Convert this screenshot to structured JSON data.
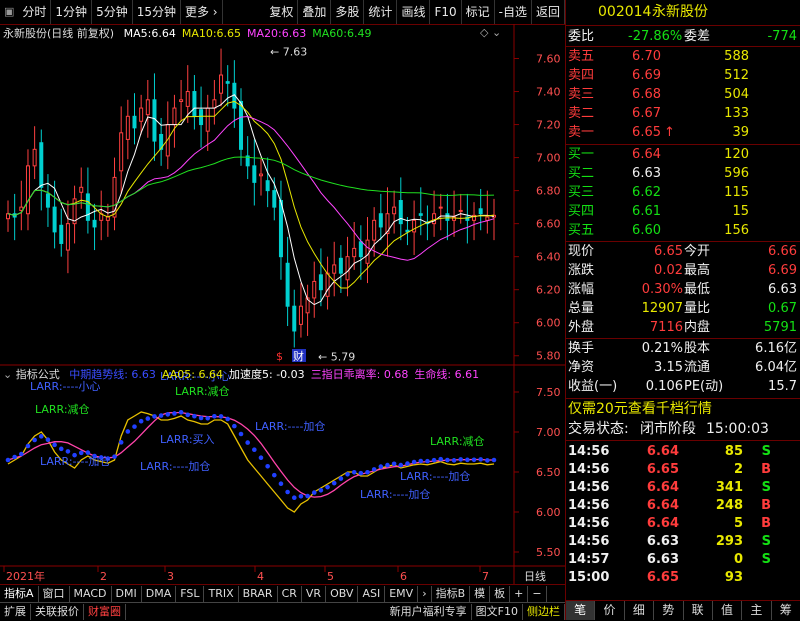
{
  "toolbar": {
    "periods": [
      "分时",
      "1分钟",
      "5分钟",
      "15分钟",
      "更多 ›"
    ],
    "tools": [
      "复权",
      "叠加",
      "多股",
      "统计",
      "画线",
      "F10",
      "标记",
      "-自选",
      "返回"
    ]
  },
  "main_chart": {
    "title": "永新股份(日线 前复权)",
    "ma": [
      {
        "label": "MA5:",
        "value": "6.64",
        "color": "#ffffff"
      },
      {
        "label": "MA10:",
        "value": "6.65",
        "color": "#e8e800"
      },
      {
        "label": "MA20:",
        "value": "6.63",
        "color": "#ff44ff"
      },
      {
        "label": "MA60:",
        "value": "6.49",
        "color": "#20e020"
      }
    ],
    "y_ticks": [
      "7.60",
      "7.40",
      "7.20",
      "7.00",
      "6.80",
      "6.60",
      "6.40",
      "6.20",
      "6.00",
      "5.80"
    ],
    "high_label": "7.63",
    "low_label": "5.79",
    "marker1": "$",
    "marker2": "财"
  },
  "indicator": {
    "title": "指标公式",
    "items": [
      {
        "label": "中期趋势线:",
        "value": "6.63",
        "color": "#3a4cff"
      },
      {
        "label": "AA05:",
        "value": "6.64",
        "color": "#e8e800"
      },
      {
        "label": "加速度5:",
        "value": "-0.03",
        "color": "#ffffff"
      },
      {
        "label": "三指日乖离率:",
        "value": "0.68",
        "color": "#ff44ff"
      },
      {
        "label": "生命线:",
        "value": "6.61",
        "color": "#ff44ff"
      }
    ],
    "y_ticks": [
      "7.50",
      "7.00",
      "6.50",
      "6.00",
      "5.50"
    ],
    "annotations": [
      {
        "text": "LARR:----小心",
        "color": "#4060ff"
      },
      {
        "text": "LARR:减仓",
        "color": "#20e020"
      },
      {
        "text": "LARR:----小心",
        "color": "#4060ff"
      },
      {
        "text": "LARR:减仓",
        "color": "#20e020"
      },
      {
        "text": "LARR:----加仓",
        "color": "#4060ff"
      },
      {
        "text": "LARR:----加仓",
        "color": "#4060ff"
      },
      {
        "text": "LARR:买入",
        "color": "#4060ff"
      },
      {
        "text": "LARR:----加仓",
        "color": "#4060ff"
      },
      {
        "text": "LARR:----加仓",
        "color": "#4060ff"
      },
      {
        "text": "LARR:----加仓",
        "color": "#4060ff"
      },
      {
        "text": "LARR:减仓",
        "color": "#20e020"
      }
    ]
  },
  "x_axis": {
    "labels": [
      "2021年",
      "2",
      "3",
      "4",
      "5",
      "6",
      "7"
    ],
    "right_label": "日线"
  },
  "tabs_row1": [
    "指标A",
    "窗口",
    "MACD",
    "DMI",
    "DMA",
    "FSL",
    "TRIX",
    "BRAR",
    "CR",
    "VR",
    "OBV",
    "ASI",
    "EMV",
    "›",
    "指标B",
    "模",
    "板",
    "+",
    "−"
  ],
  "tabs_row2": {
    "left": [
      "扩展",
      "关联报价",
      "财富圈"
    ],
    "right": [
      "新用户福利专享",
      "图文F10",
      "侧边栏"
    ]
  },
  "quote": {
    "code": "002014",
    "name": "永新股份",
    "weibi_label": "委比",
    "weibi": "-27.86%",
    "weicha_label": "委差",
    "weicha": "-774",
    "sells": [
      {
        "label": "卖五",
        "price": "6.70",
        "vol": "588",
        "arrow": ""
      },
      {
        "label": "卖四",
        "price": "6.69",
        "vol": "512",
        "arrow": ""
      },
      {
        "label": "卖三",
        "price": "6.68",
        "vol": "504",
        "arrow": ""
      },
      {
        "label": "卖二",
        "price": "6.67",
        "vol": "133",
        "arrow": ""
      },
      {
        "label": "卖一",
        "price": "6.65",
        "vol": "39",
        "arrow": "↑"
      }
    ],
    "buys": [
      {
        "label": "买一",
        "price": "6.64",
        "vol": "120",
        "pc": "red"
      },
      {
        "label": "买二",
        "price": "6.63",
        "vol": "596",
        "pc": "wht"
      },
      {
        "label": "买三",
        "price": "6.62",
        "vol": "115",
        "pc": "grn"
      },
      {
        "label": "买四",
        "price": "6.61",
        "vol": "15",
        "pc": "grn"
      },
      {
        "label": "买五",
        "price": "6.60",
        "vol": "156",
        "pc": "grn"
      }
    ],
    "stats": [
      {
        "l1": "现价",
        "v1": "6.65",
        "c1": "red",
        "l2": "今开",
        "v2": "6.66",
        "c2": "red"
      },
      {
        "l1": "涨跌",
        "v1": "0.02",
        "c1": "red",
        "l2": "最高",
        "v2": "6.69",
        "c2": "red"
      },
      {
        "l1": "涨幅",
        "v1": "0.30%",
        "c1": "red",
        "l2": "最低",
        "v2": "6.63",
        "c2": "wht"
      },
      {
        "l1": "总量",
        "v1": "12907",
        "c1": "yel",
        "l2": "量比",
        "v2": "0.67",
        "c2": "grn"
      },
      {
        "l1": "外盘",
        "v1": "7116",
        "c1": "red",
        "l2": "内盘",
        "v2": "5791",
        "c2": "grn"
      }
    ],
    "stats2": [
      {
        "l1": "换手",
        "v1": "0.21%",
        "l2": "股本",
        "v2": "6.16亿"
      },
      {
        "l1": "净资",
        "v1": "3.15",
        "l2": "流通",
        "v2": "6.04亿"
      },
      {
        "l1": "收益(一)",
        "v1": "0.106",
        "l2": "PE(动)",
        "v2": "15.7"
      }
    ],
    "promo": "仅需20元查看千档行情",
    "status_label": "交易状态:",
    "status": "闭市阶段",
    "status_time": "15:00:03",
    "trades": [
      {
        "t": "14:56",
        "p": "6.64",
        "pc": "red",
        "v": "85",
        "bs": "S"
      },
      {
        "t": "14:56",
        "p": "6.65",
        "pc": "red",
        "v": "2",
        "bs": "B"
      },
      {
        "t": "14:56",
        "p": "6.64",
        "pc": "red",
        "v": "341",
        "bs": "S"
      },
      {
        "t": "14:56",
        "p": "6.64",
        "pc": "red",
        "v": "248",
        "bs": "B"
      },
      {
        "t": "14:56",
        "p": "6.64",
        "pc": "red",
        "v": "5",
        "bs": "B"
      },
      {
        "t": "14:56",
        "p": "6.63",
        "pc": "wht",
        "v": "293",
        "bs": "S"
      },
      {
        "t": "14:57",
        "p": "6.63",
        "pc": "wht",
        "v": "0",
        "bs": "S"
      },
      {
        "t": "15:00",
        "p": "6.65",
        "pc": "red",
        "v": "93",
        "bs": ""
      }
    ],
    "bottom_tabs": [
      "笔",
      "价",
      "细",
      "势",
      "联",
      "值",
      "主",
      "筹"
    ]
  }
}
